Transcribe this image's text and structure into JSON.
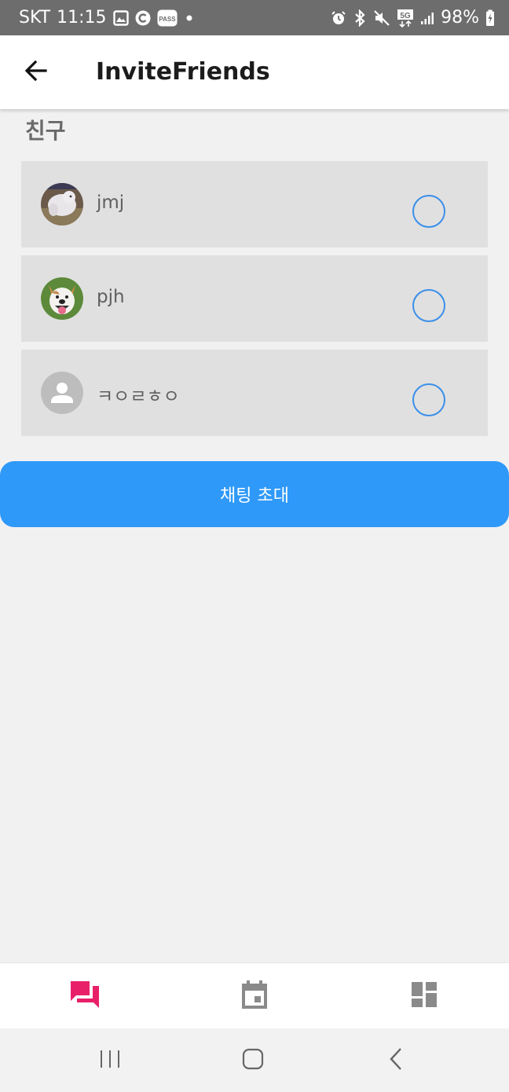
{
  "status_bar": {
    "carrier": "SKT",
    "time": "11:15",
    "network": "5G",
    "battery": "98%",
    "left_icons": [
      "image-icon",
      "c-circle-icon",
      "pass-icon",
      "dot-icon"
    ],
    "pass_label": "PASS",
    "right_icons": [
      "alarm-icon",
      "bluetooth-icon",
      "mute-icon",
      "5g-icon",
      "signal-icon",
      "battery-charging-icon"
    ]
  },
  "app_bar": {
    "title": "InviteFriends",
    "back_icon": "arrow-left-icon"
  },
  "section": {
    "title": "친구"
  },
  "friends": [
    {
      "name": "jmj",
      "avatar": "dog-photo-white-fluffy",
      "selected": false
    },
    {
      "name": "pjh",
      "avatar": "dog-photo-smiling",
      "selected": false
    },
    {
      "name": "ㅋㅇㄹㅎㅇ",
      "avatar": "default-person-icon",
      "selected": false
    }
  ],
  "invite_button": {
    "label": "채팅 초대"
  },
  "bottom_nav": {
    "items": [
      {
        "icon": "chat-forum-icon",
        "active": true
      },
      {
        "icon": "calendar-icon",
        "active": false
      },
      {
        "icon": "dashboard-icon",
        "active": false
      }
    ]
  },
  "system_nav": {
    "items": [
      "recent-apps-icon",
      "home-icon",
      "back-icon"
    ]
  },
  "colors": {
    "accent": "#2e99f8",
    "radio_border": "#3a8fea",
    "nav_active": "#e8206a",
    "nav_inactive": "#8a8a8a",
    "status_bar": "#6d6d6d",
    "background": "#f1f1f1",
    "list_item_bg": "#e0e0e0"
  }
}
